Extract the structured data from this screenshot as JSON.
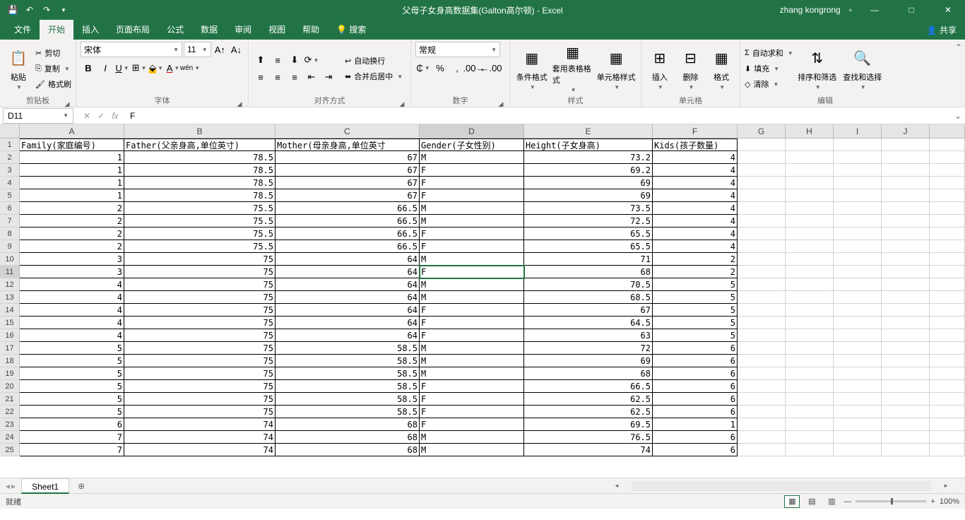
{
  "title": "父母子女身高数据集(Galton高尔顿) - Excel",
  "user": "zhang kongrong",
  "share": "共享",
  "tabs": {
    "file": "文件",
    "active": "开始",
    "list": [
      "插入",
      "页面布局",
      "公式",
      "数据",
      "审阅",
      "视图",
      "帮助"
    ],
    "search": "搜索"
  },
  "clipboard": {
    "paste": "粘贴",
    "cut": "剪切",
    "copy": "复制",
    "painter": "格式刷",
    "label": "剪贴板"
  },
  "font": {
    "name": "宋体",
    "size": "11",
    "label": "字体",
    "pinyin": "wén"
  },
  "align": {
    "wrap": "自动换行",
    "merge": "合并后居中",
    "label": "对齐方式"
  },
  "number": {
    "format": "常规",
    "label": "数字"
  },
  "styles": {
    "cond": "条件格式",
    "table": "套用表格格式",
    "cell": "单元格样式",
    "label": "样式"
  },
  "cells": {
    "insert": "插入",
    "delete": "删除",
    "format": "格式",
    "label": "单元格"
  },
  "editing": {
    "sum": "自动求和",
    "fill": "填充",
    "clear": "清除",
    "sort": "排序和筛选",
    "find": "查找和选择",
    "label": "编辑"
  },
  "namebox": "D11",
  "fx_value": "F",
  "columns": [
    "A",
    "B",
    "C",
    "D",
    "E",
    "F",
    "G",
    "H",
    "I",
    "J"
  ],
  "headers": [
    "Family(家庭编号)",
    "Father(父亲身高,单位英寸)",
    "Mother(母亲身高,单位英寸",
    "Gender(子女性别)",
    "Height(子女身高)",
    "Kids(孩子数量)"
  ],
  "rows": [
    [
      1,
      78.5,
      67,
      "M",
      73.2,
      4
    ],
    [
      1,
      78.5,
      67,
      "F",
      69.2,
      4
    ],
    [
      1,
      78.5,
      67,
      "F",
      69,
      4
    ],
    [
      1,
      78.5,
      67,
      "F",
      69,
      4
    ],
    [
      2,
      75.5,
      66.5,
      "M",
      73.5,
      4
    ],
    [
      2,
      75.5,
      66.5,
      "M",
      72.5,
      4
    ],
    [
      2,
      75.5,
      66.5,
      "F",
      65.5,
      4
    ],
    [
      2,
      75.5,
      66.5,
      "F",
      65.5,
      4
    ],
    [
      3,
      75,
      64,
      "M",
      71,
      2
    ],
    [
      3,
      75,
      64,
      "F",
      68,
      2
    ],
    [
      4,
      75,
      64,
      "M",
      70.5,
      5
    ],
    [
      4,
      75,
      64,
      "M",
      68.5,
      5
    ],
    [
      4,
      75,
      64,
      "F",
      67,
      5
    ],
    [
      4,
      75,
      64,
      "F",
      64.5,
      5
    ],
    [
      4,
      75,
      64,
      "F",
      63,
      5
    ],
    [
      5,
      75,
      58.5,
      "M",
      72,
      6
    ],
    [
      5,
      75,
      58.5,
      "M",
      69,
      6
    ],
    [
      5,
      75,
      58.5,
      "M",
      68,
      6
    ],
    [
      5,
      75,
      58.5,
      "F",
      66.5,
      6
    ],
    [
      5,
      75,
      58.5,
      "F",
      62.5,
      6
    ],
    [
      5,
      75,
      58.5,
      "F",
      62.5,
      6
    ],
    [
      6,
      74,
      68,
      "F",
      69.5,
      1
    ],
    [
      7,
      74,
      68,
      "M",
      76.5,
      6
    ],
    [
      7,
      74,
      68,
      "M",
      74,
      6
    ]
  ],
  "active_cell": {
    "row": 11,
    "col": "D"
  },
  "sheet_tab": "Sheet1",
  "status": "就绪",
  "zoom": "100%"
}
